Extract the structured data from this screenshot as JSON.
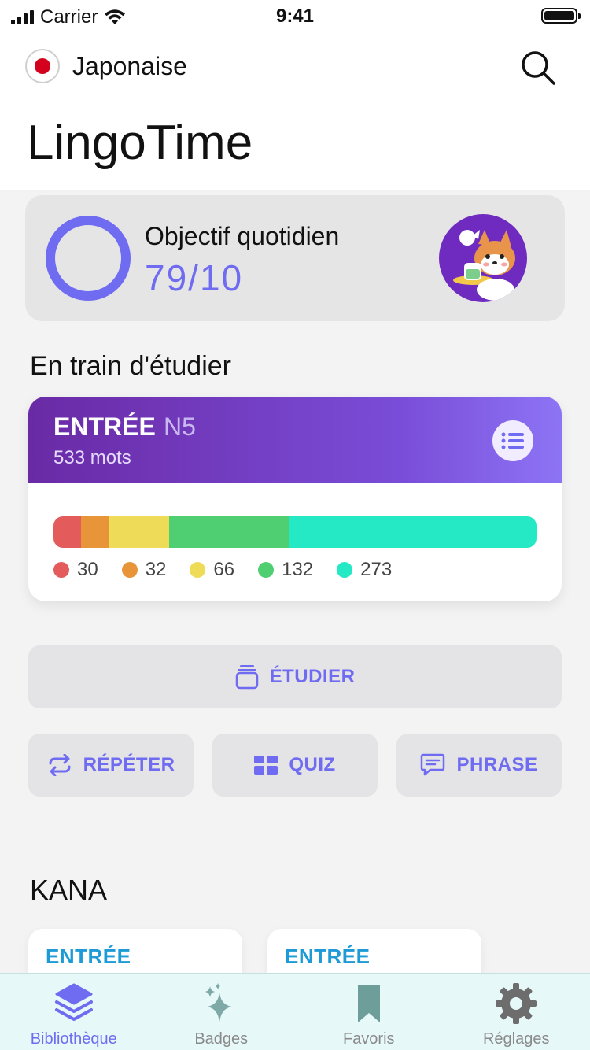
{
  "status_bar": {
    "carrier": "Carrier",
    "time": "9:41"
  },
  "language": {
    "name": "Japonaise"
  },
  "app": {
    "title": "LingoTime"
  },
  "daily_goal": {
    "label": "Objectif quotidien",
    "value": "79/10"
  },
  "studying": {
    "section_title": "En train d'étudier",
    "deck": {
      "name": "ENTRÉE",
      "level": "N5",
      "count": "533 mots",
      "segments": [
        {
          "value": "30",
          "color": "#e45b5b"
        },
        {
          "value": "32",
          "color": "#e8953a"
        },
        {
          "value": "66",
          "color": "#eedb58"
        },
        {
          "value": "132",
          "color": "#4fce72"
        },
        {
          "value": "273",
          "color": "#25e8c4"
        }
      ]
    }
  },
  "actions": {
    "study": "ÉTUDIER",
    "repeat": "RÉPÉTER",
    "quiz": "QUIZ",
    "phrase": "PHRASE"
  },
  "kana": {
    "title": "KANA",
    "cards": [
      {
        "label": "ENTRÉE"
      },
      {
        "label": "ENTRÉE"
      }
    ]
  },
  "tabs": [
    {
      "label": "Bibliothèque",
      "icon": "layers-icon",
      "active": true
    },
    {
      "label": "Badges",
      "icon": "sparkles-icon",
      "active": false
    },
    {
      "label": "Favoris",
      "icon": "bookmark-icon",
      "active": false
    },
    {
      "label": "Réglages",
      "icon": "gear-icon",
      "active": false
    }
  ],
  "colors": {
    "accent": "#6f6cf1",
    "kana_label": "#1e9bd6"
  }
}
